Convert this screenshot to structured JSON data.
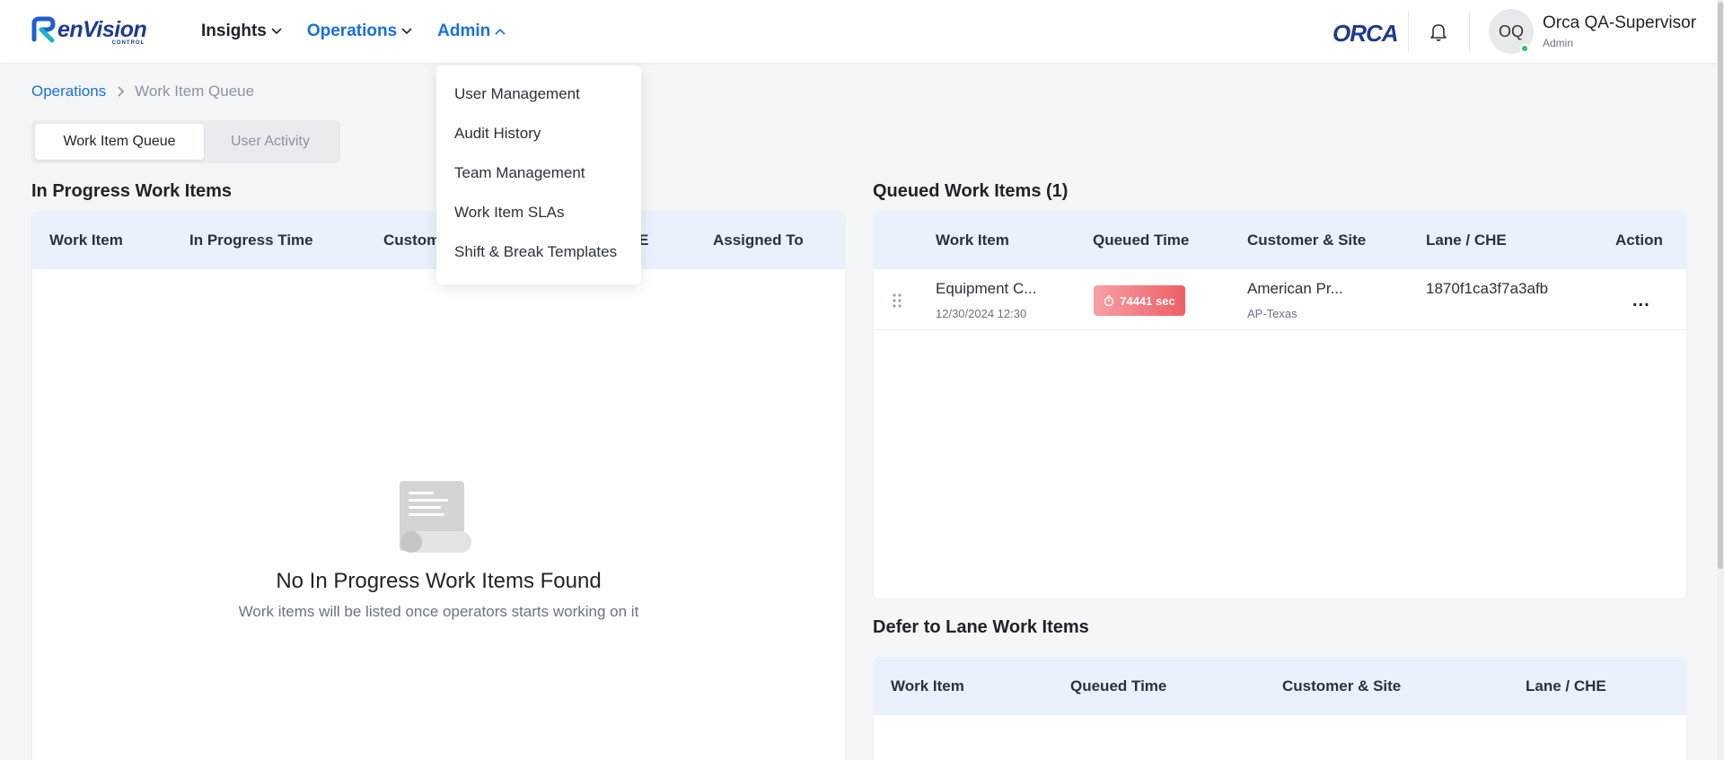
{
  "header": {
    "logo_text": "enVision",
    "logo_sub": "CONTROL",
    "nav": [
      {
        "label": "Insights"
      },
      {
        "label": "Operations"
      },
      {
        "label": "Admin"
      }
    ],
    "brand_logo": "ORCA",
    "user": {
      "initials": "OQ",
      "name": "Orca QA-Supervisor",
      "role": "Admin"
    }
  },
  "breadcrumb": {
    "parent": "Operations",
    "current": "Work Item Queue"
  },
  "tabs": [
    {
      "label": "Work Item Queue",
      "active": true
    },
    {
      "label": "User Activity",
      "active": false
    }
  ],
  "admin_menu": {
    "items": [
      "User Management",
      "Audit History",
      "Team Management",
      "Work Item SLAs",
      "Shift & Break Templates"
    ]
  },
  "in_progress": {
    "title": "In Progress Work Items",
    "columns": [
      "Work Item",
      "In Progress Time",
      "Custom",
      "E",
      "Assigned To"
    ],
    "empty_title": "No In Progress Work Items Found",
    "empty_subtitle": "Work items will be listed once operators starts working on it"
  },
  "queued": {
    "title": "Queued Work Items (1)",
    "columns": [
      "Work Item",
      "Queued Time",
      "Customer & Site",
      "Lane / CHE",
      "Action"
    ],
    "rows": [
      {
        "work_item": "Equipment C...",
        "date": "12/30/2024 12:30",
        "queued_time": "74441 sec",
        "customer": "American Pr...",
        "site": "AP-Texas",
        "lane": "1870f1ca3f7a3afb",
        "action": "..."
      }
    ]
  },
  "defer": {
    "title": "Defer to Lane Work Items",
    "columns": [
      "Work Item",
      "Queued Time",
      "Customer & Site",
      "Lane / CHE"
    ]
  },
  "colors": {
    "accent": "#1a6fdc",
    "header_row": "#eaf1fc",
    "timer_badge": "#ee5f66",
    "online": "#29c26a"
  },
  "icons": [
    "envision-logo-icon",
    "chevron-down-icon",
    "chevron-up-icon",
    "bell-icon",
    "drag-handle-icon",
    "timer-icon",
    "document-icon"
  ]
}
